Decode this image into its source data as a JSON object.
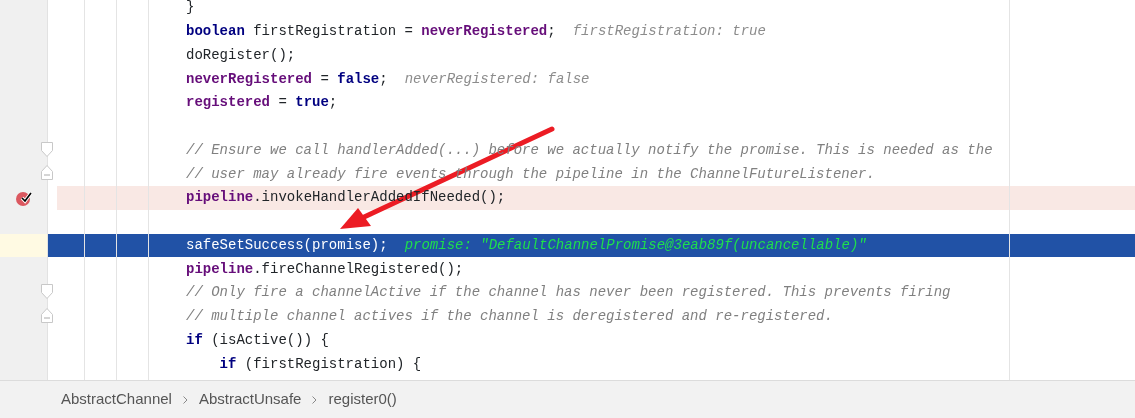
{
  "editor": {
    "lines": [
      {
        "breakpoint": false,
        "execution_point": false,
        "tokens": [
          {
            "kind": "plain",
            "text": "}"
          }
        ]
      },
      {
        "breakpoint": false,
        "execution_point": false,
        "tokens": [
          {
            "kind": "keyword",
            "text": "boolean"
          },
          {
            "kind": "plain",
            "text": " firstRegistration = "
          },
          {
            "kind": "field",
            "text": "neverRegistered"
          },
          {
            "kind": "plain",
            "text": ";"
          }
        ],
        "hint": "firstRegistration: true"
      },
      {
        "breakpoint": false,
        "execution_point": false,
        "tokens": [
          {
            "kind": "plain",
            "text": "doRegister();"
          }
        ]
      },
      {
        "breakpoint": false,
        "execution_point": false,
        "tokens": [
          {
            "kind": "field",
            "text": "neverRegistered"
          },
          {
            "kind": "plain",
            "text": " = "
          },
          {
            "kind": "keyword",
            "text": "false"
          },
          {
            "kind": "plain",
            "text": ";"
          }
        ],
        "hint": "neverRegistered: false"
      },
      {
        "breakpoint": false,
        "execution_point": false,
        "tokens": [
          {
            "kind": "field",
            "text": "registered"
          },
          {
            "kind": "plain",
            "text": " = "
          },
          {
            "kind": "keyword",
            "text": "true"
          },
          {
            "kind": "plain",
            "text": ";"
          }
        ]
      },
      {
        "breakpoint": false,
        "execution_point": false
      },
      {
        "breakpoint": false,
        "execution_point": false,
        "fold": {
          "kind": "start"
        },
        "tokens": [
          {
            "kind": "comment",
            "text": "// Ensure we call handlerAdded(...) before we actually notify the promise. This is needed as the"
          }
        ]
      },
      {
        "breakpoint": false,
        "execution_point": false,
        "fold": {
          "kind": "end"
        },
        "tokens": [
          {
            "kind": "comment",
            "text": "// user may already fire events through the pipeline in the ChannelFutureListener."
          }
        ]
      },
      {
        "breakpoint": true,
        "execution_point": false,
        "tokens": [
          {
            "kind": "field",
            "text": "pipeline"
          },
          {
            "kind": "plain",
            "text": ".invokeHandlerAddedIfNeeded();"
          }
        ]
      },
      {
        "breakpoint": false,
        "execution_point": false
      },
      {
        "breakpoint": false,
        "execution_point": true,
        "tokens": [
          {
            "kind": "plain",
            "text": "safeSetSuccess(promise);"
          }
        ],
        "hint": "promise: \"DefaultChannelPromise@3eab89f(uncancellable)\""
      },
      {
        "breakpoint": false,
        "execution_point": false,
        "tokens": [
          {
            "kind": "field",
            "text": "pipeline"
          },
          {
            "kind": "plain",
            "text": ".fireChannelRegistered();"
          }
        ]
      },
      {
        "breakpoint": false,
        "execution_point": false,
        "fold": {
          "kind": "start"
        },
        "tokens": [
          {
            "kind": "comment",
            "text": "// Only fire a channelActive if the channel has never been registered. This prevents firing"
          }
        ]
      },
      {
        "breakpoint": false,
        "execution_point": false,
        "fold": {
          "kind": "end"
        },
        "tokens": [
          {
            "kind": "comment",
            "text": "// multiple channel actives if the channel is deregistered and re-registered."
          }
        ]
      },
      {
        "breakpoint": false,
        "execution_point": false,
        "tokens": [
          {
            "kind": "keyword",
            "text": "if"
          },
          {
            "kind": "plain",
            "text": " (isActive()) {"
          }
        ],
        "children": [
          {
            "breakpoint": false,
            "execution_point": false,
            "tokens": [
              {
                "kind": "keyword",
                "text": "if"
              },
              {
                "kind": "plain",
                "text": " (firstRegistration) {"
              }
            ]
          }
        ]
      }
    ]
  },
  "annotation": {
    "kind": "arrow"
  },
  "breadcrumbs": [
    "AbstractChannel",
    "AbstractUnsafe",
    "register0()"
  ]
}
